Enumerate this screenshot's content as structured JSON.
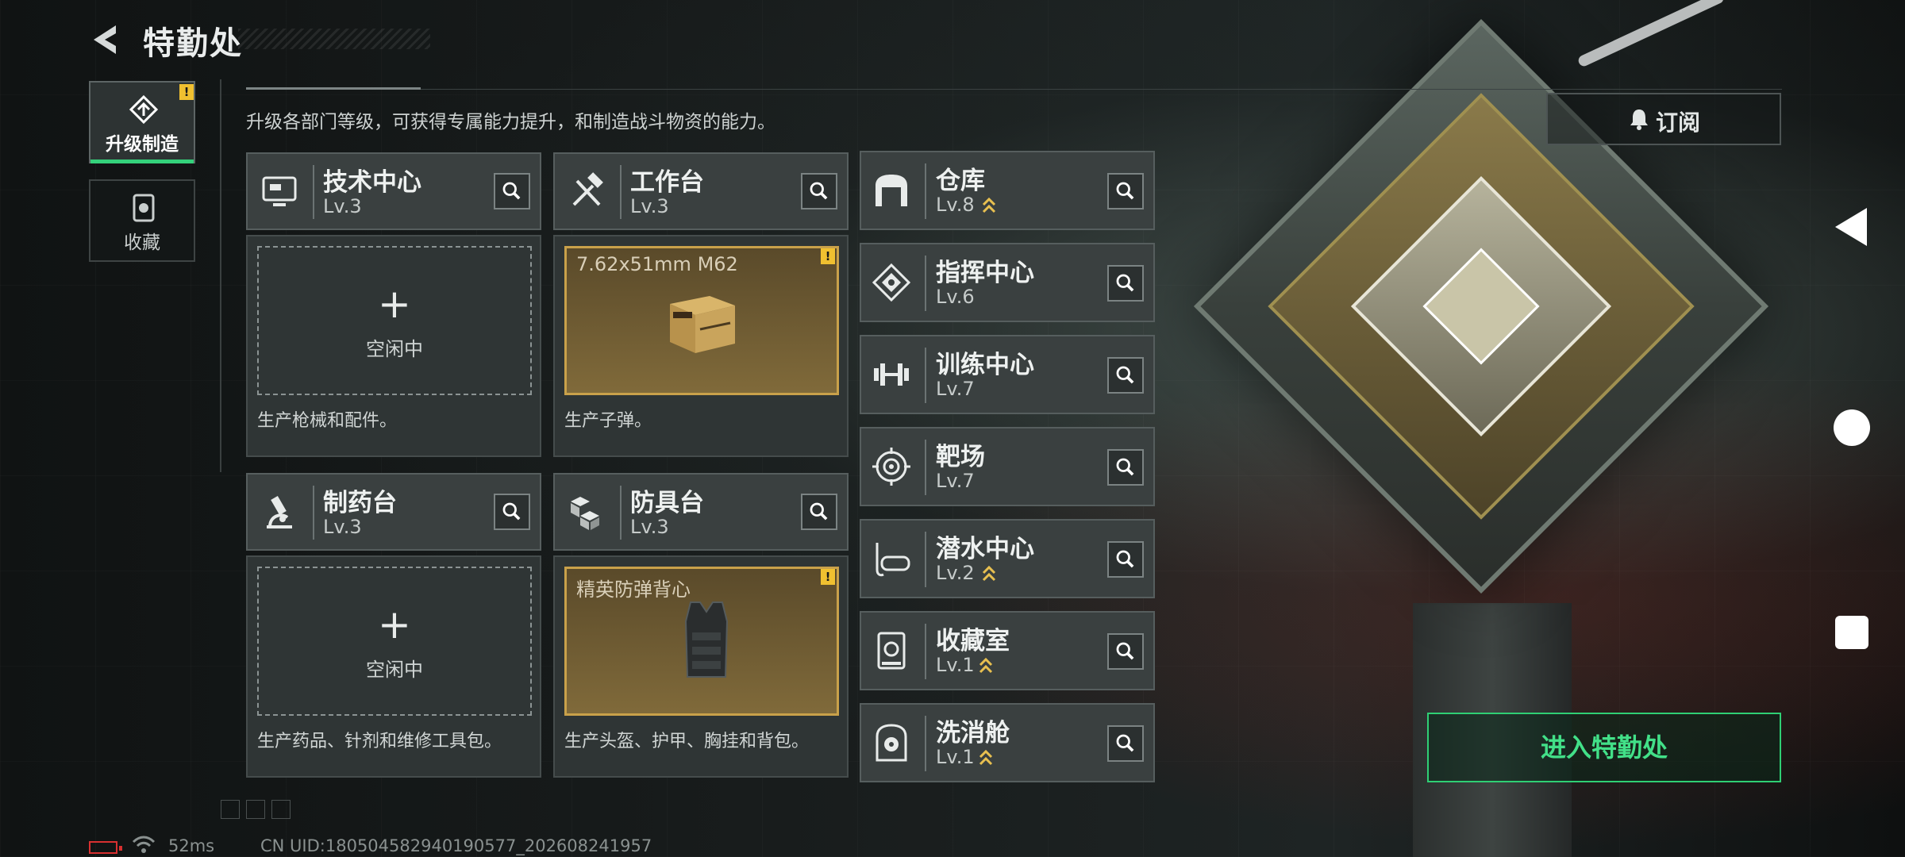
{
  "header": {
    "title": "特勤处"
  },
  "nav": {
    "items": [
      {
        "label": "升级制造",
        "icon": "upgrade-icon",
        "active": true,
        "badge": "!"
      },
      {
        "label": "收藏",
        "icon": "collection-icon",
        "active": false
      }
    ]
  },
  "intro": "升级各部门等级，可获得专属能力提升，和制造战斗物资的能力。",
  "subscribe": {
    "label": "订阅",
    "icon": "bell-icon"
  },
  "facilities": [
    {
      "name": "技术中心",
      "level": "Lv.3",
      "icon": "monitor-icon",
      "slot": {
        "state": "idle",
        "plus": "+",
        "idle_text": "空闲中"
      },
      "desc": "生产枪械和配件。"
    },
    {
      "name": "工作台",
      "level": "Lv.3",
      "icon": "tools-icon",
      "slot": {
        "state": "producing",
        "item": "7.62x51mm M62",
        "badge": "!"
      },
      "desc": "生产子弹。"
    },
    {
      "name": "制药台",
      "level": "Lv.3",
      "icon": "microscope-icon",
      "slot": {
        "state": "idle",
        "plus": "+",
        "idle_text": "空闲中"
      },
      "desc": "生产药品、针剂和维修工具包。"
    },
    {
      "name": "防具台",
      "level": "Lv.3",
      "icon": "cubes-icon",
      "slot": {
        "state": "producing",
        "item": "精英防弹背心",
        "badge": "!"
      },
      "desc": "生产头盔、护甲、胸挂和背包。"
    }
  ],
  "tiles": [
    {
      "name": "仓库",
      "level": "Lv.8",
      "icon": "warehouse-icon",
      "upgradable": true
    },
    {
      "name": "指挥中心",
      "level": "Lv.6",
      "icon": "command-icon",
      "upgradable": false
    },
    {
      "name": "训练中心",
      "level": "Lv.7",
      "icon": "dumbbell-icon",
      "upgradable": false
    },
    {
      "name": "靶场",
      "level": "Lv.7",
      "icon": "target-icon",
      "upgradable": false
    },
    {
      "name": "潜水中心",
      "level": "Lv.2",
      "icon": "diving-mask-icon",
      "upgradable": true
    },
    {
      "name": "收藏室",
      "level": "Lv.1",
      "icon": "display-case-icon",
      "upgradable": true
    },
    {
      "name": "洗消舱",
      "level": "Lv.1",
      "icon": "decon-icon",
      "upgradable": true
    }
  ],
  "enter_button": "进入特勤处",
  "status": {
    "ping": "52ms",
    "uid": "CN UID:180504582940190577_202608241957"
  },
  "colors": {
    "accent_green": "#34d17b",
    "warning_yellow": "#f0c030",
    "slot_gold": "#c9a14a"
  }
}
